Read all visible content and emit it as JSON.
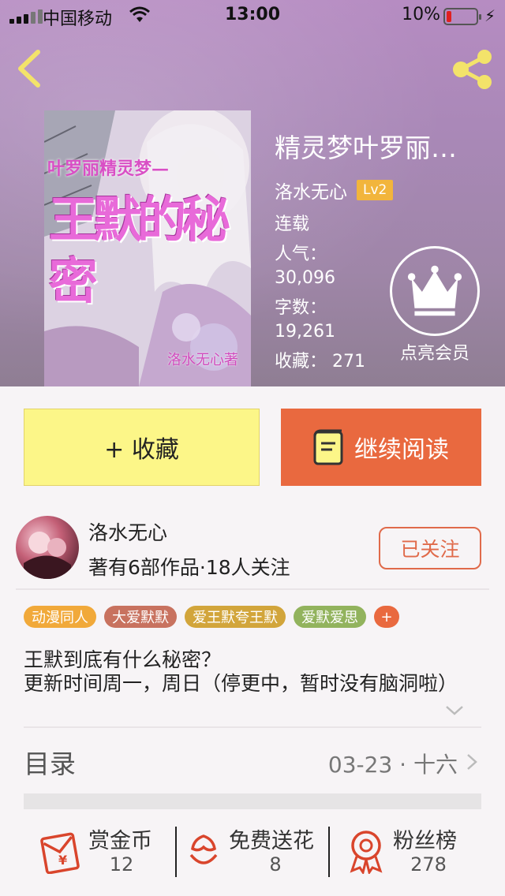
{
  "status_bar": {
    "carrier": "中国移动",
    "time": "13:00",
    "battery": "10%",
    "battery_level": 0.1
  },
  "book": {
    "title": "精灵梦叶罗丽…",
    "author": "洛水无心",
    "level": "Lv2",
    "status": "连载",
    "popularity_label": "人气：",
    "popularity": "30,096",
    "wordcount_label": "字数：",
    "wordcount": "19,261",
    "favorites": "收藏：  271",
    "cover": {
      "top_text": "叶罗丽精灵梦—",
      "title_text": "王默的秘密",
      "author_text": "洛水无心著"
    }
  },
  "vip": {
    "label": "点亮会员"
  },
  "actions": {
    "favorite_label": "+ 收藏",
    "read_label": "继续阅读"
  },
  "author_card": {
    "name": "洛水无心",
    "meta": "著有6部作品·18人关注",
    "follow_label": "已关注"
  },
  "tags": [
    {
      "label": "动漫同人",
      "color": "#f1a93a"
    },
    {
      "label": "大爱默默",
      "color": "#c8725f"
    },
    {
      "label": "爱王默夸王默",
      "color": "#d2a53b"
    },
    {
      "label": "爱默爱思",
      "color": "#92b35d"
    }
  ],
  "tag_more": "+",
  "description": {
    "line1": "王默到底有什么秘密？",
    "line2": "更新时间周一，周日（停更中，暂时没有脑洞啦）"
  },
  "toc": {
    "label": "目录",
    "latest": "03-23 · 十六"
  },
  "stats": {
    "coins": {
      "label": "赏金币",
      "value": "12"
    },
    "flowers": {
      "label": "免费送花",
      "value": "8"
    },
    "fans": {
      "label": "粉丝榜",
      "value": "278"
    }
  },
  "colors": {
    "accent": "#e9693f",
    "favorite_button": "#fcf688",
    "icon_red": "#d9452c"
  }
}
